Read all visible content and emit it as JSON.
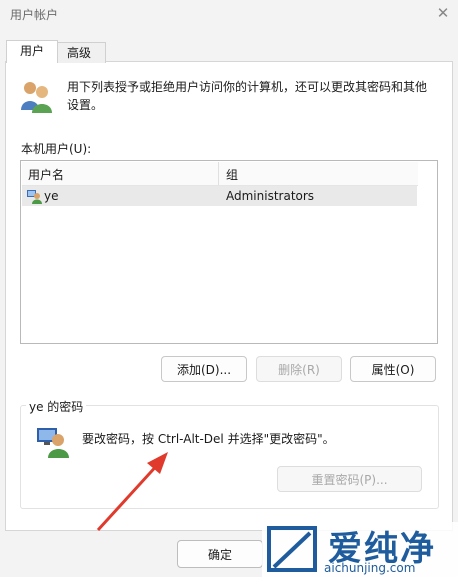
{
  "window": {
    "title": "用户帐户",
    "close_symbol": "✕"
  },
  "tabs": [
    {
      "label": "用户"
    },
    {
      "label": "高级"
    }
  ],
  "description": "用下列表授予或拒绝用户访问你的计算机，还可以更改其密码和其他设置。",
  "local_users_label": "本机用户(U):",
  "table": {
    "columns": [
      "用户名",
      "组"
    ],
    "rows": [
      {
        "username": "ye",
        "group": "Administrators"
      }
    ]
  },
  "buttons": {
    "add": "添加(D)...",
    "remove": "删除(R)",
    "properties": "属性(O)",
    "reset_password": "重置密码(P)...",
    "ok": "确定"
  },
  "password_group": {
    "title": "ye 的密码",
    "text": "要改密码，按 Ctrl-Alt-Del 并选择\"更改密码\"。"
  },
  "watermark": {
    "brand": "爱纯净",
    "url": "aichunjing.com"
  },
  "colors": {
    "arrow": "#e03a2c",
    "brand": "#1f5c9e"
  }
}
